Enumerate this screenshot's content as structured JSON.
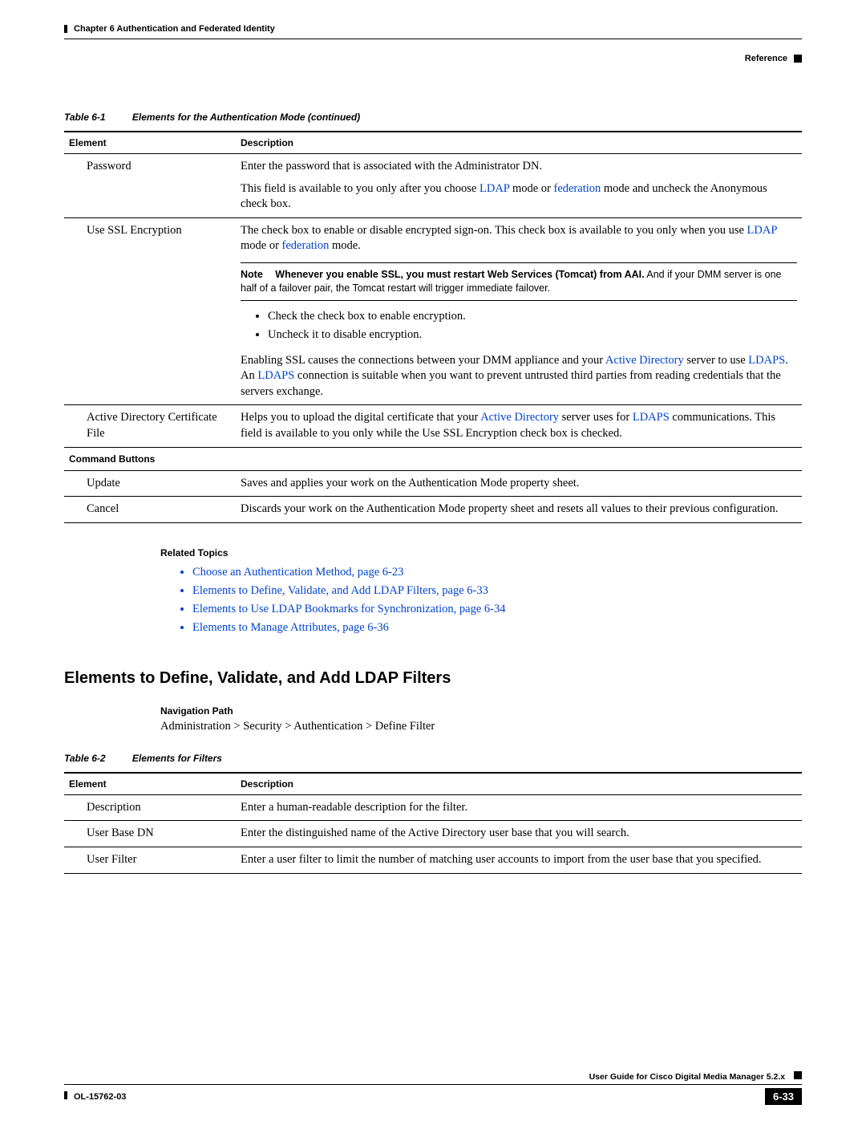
{
  "header": {
    "chapter": "Chapter 6      Authentication and Federated Identity",
    "reference": "Reference"
  },
  "table1": {
    "caption_num": "Table 6-1",
    "caption_title": "Elements for the Authentication Mode (continued)",
    "col_element": "Element",
    "col_description": "Description",
    "rows": {
      "password": {
        "el": "Password",
        "p1a": "Enter the password that is associated with the Administrator DN.",
        "p2a": "This field is available to you only after you choose ",
        "p2b": "LDAP",
        "p2c": " mode or ",
        "p2d": "federation",
        "p2e": " mode and uncheck the Anonymous check box."
      },
      "ssl": {
        "el": "Use SSL Encryption",
        "p1a": "The check box to enable or disable encrypted sign-on. This check box is available to you only when you use ",
        "p1b": "LDAP",
        "p1c": " mode or ",
        "p1d": "federation",
        "p1e": " mode.",
        "note_label": "Note",
        "note_bold": "Whenever you enable SSL, you must restart Web Services (Tomcat) from AAI.",
        "note_rest": " And if your DMM server is one half of a failover pair, the Tomcat restart will trigger immediate failover.",
        "b1": "Check the check box to enable encryption.",
        "b2": "Uncheck it to disable encryption.",
        "p2a": "Enabling SSL causes the connections between your DMM appliance and your ",
        "p2b": "Active Directory",
        "p2c": " server to use ",
        "p2d": "LDAPS",
        "p2e": ". An ",
        "p2f": "LDAPS",
        "p2g": " connection is suitable when you want to prevent untrusted third parties from reading credentials that the servers exchange."
      },
      "cert": {
        "el": "Active Directory Certificate File",
        "p1a": "Helps you to upload the digital certificate that your ",
        "p1b": "Active Directory",
        "p1c": " server uses for ",
        "p1d": "LDAPS",
        "p1e": " communications. This field is available to you only while the Use SSL Encryption check box is checked."
      }
    },
    "cmd_heading": "Command Buttons",
    "cmd": {
      "update_el": "Update",
      "update_d": "Saves and applies your work on the Authentication Mode property sheet.",
      "cancel_el": "Cancel",
      "cancel_d": "Discards your work on the Authentication Mode property sheet and resets all values to their previous configuration."
    }
  },
  "related": {
    "heading": "Related Topics",
    "items": [
      "Choose an Authentication Method, page 6-23",
      "Elements to Define, Validate, and Add LDAP Filters, page 6-33",
      "Elements to Use LDAP Bookmarks for Synchronization, page 6-34",
      "Elements to Manage Attributes, page 6-36"
    ]
  },
  "section2": {
    "title": "Elements to Define, Validate, and Add LDAP Filters",
    "nav_h": "Navigation Path",
    "nav_p": "Administration > Security > Authentication > Define Filter"
  },
  "table2": {
    "caption_num": "Table 6-2",
    "caption_title": "Elements for Filters",
    "col_element": "Element",
    "col_description": "Description",
    "rows": {
      "desc": {
        "el": "Description",
        "d": "Enter a human-readable description for the filter."
      },
      "base": {
        "el": "User Base DN",
        "d": "Enter the distinguished name of the Active Directory user base that you will search."
      },
      "filter": {
        "el": "User Filter",
        "d": "Enter a user filter to limit the number of matching user accounts to import from the user base that you specified."
      }
    }
  },
  "footer": {
    "book": "User Guide for Cisco Digital Media Manager 5.2.x",
    "doc": "OL-15762-03",
    "page": "6-33"
  }
}
